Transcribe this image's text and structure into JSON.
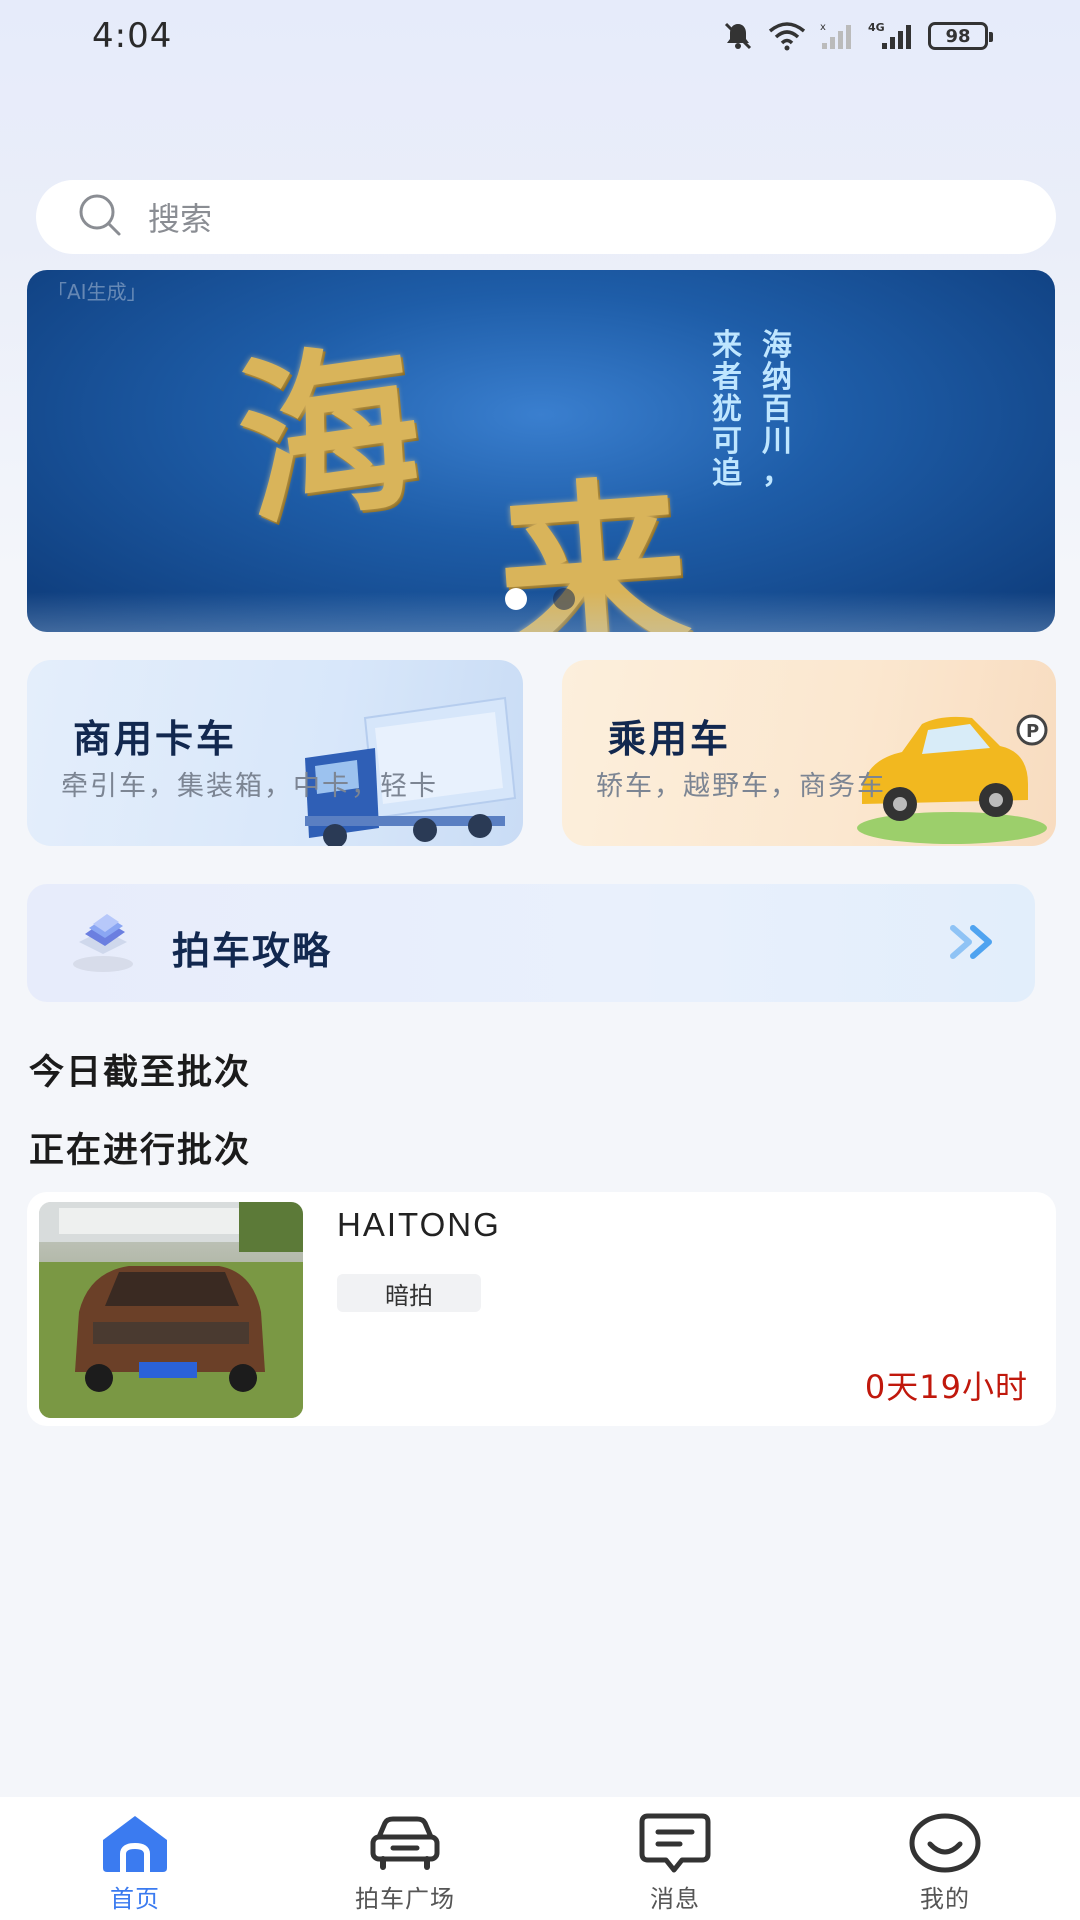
{
  "status_bar": {
    "time": "4:04",
    "battery": "98"
  },
  "search": {
    "placeholder": "搜索"
  },
  "banner": {
    "watermark": "「AI生成」",
    "headline_char_1": "海",
    "headline_char_2": "来",
    "vertical_line_1": "海纳百川，",
    "vertical_line_2": "来者犹可追",
    "page_count": 2,
    "active_page": 1
  },
  "categories": [
    {
      "title": "商用卡车",
      "subtitle": "牵引车，集装箱，中卡，轻卡"
    },
    {
      "title": "乘用车",
      "subtitle": "轿车，越野车，商务车"
    }
  ],
  "guide": {
    "label": "拍车攻略"
  },
  "sections": {
    "today_closing": "今日截至批次",
    "in_progress": "正在进行批次"
  },
  "batch": {
    "name": "HAITONG",
    "tag": "暗拍",
    "remaining": "0天19小时"
  },
  "bottom_nav": [
    {
      "label": "首页",
      "icon": "home-icon",
      "active": true
    },
    {
      "label": "拍车广场",
      "icon": "car-icon",
      "active": false
    },
    {
      "label": "消息",
      "icon": "message-icon",
      "active": false
    },
    {
      "label": "我的",
      "icon": "smile-icon",
      "active": false
    }
  ],
  "colors": {
    "accent": "#3b7bf0",
    "countdown": "#c0180c",
    "title_navy": "#12284f"
  }
}
